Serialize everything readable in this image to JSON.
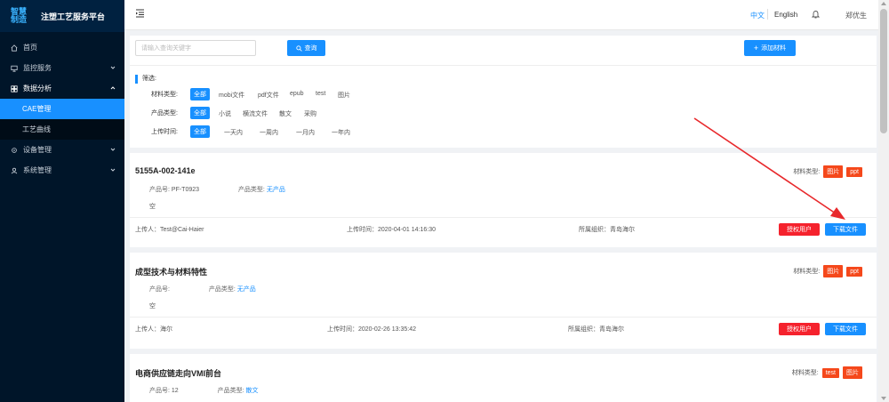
{
  "sidebar": {
    "logo_line1": "智慧",
    "logo_line2": "制造",
    "title": "注塑工艺服务平台",
    "items": [
      {
        "label": "首页"
      },
      {
        "label": "监控服务"
      },
      {
        "label": "数据分析"
      },
      {
        "label": "设备管理"
      },
      {
        "label": "系统管理"
      }
    ],
    "sub_items": [
      {
        "label": "CAE管理"
      },
      {
        "label": "工艺曲线"
      }
    ]
  },
  "header": {
    "lang_zh": "中文",
    "lang_en": "English",
    "user": "郑优生"
  },
  "search": {
    "placeholder": "请输入查询关键字",
    "query_label": "查询",
    "add_label": "添加材料"
  },
  "filter": {
    "title": "筛选:",
    "material_label": "材料类型:",
    "material_options": [
      "全部",
      "mobi文件",
      "pdf文件",
      "epub",
      "test",
      "图片"
    ],
    "product_label": "产品类型:",
    "product_options": [
      "全部",
      "小说",
      "横流文件",
      "散文",
      "采购"
    ],
    "time_label": "上传时间:",
    "time_options": [
      "全部",
      "一天内",
      "一周内",
      "一月内",
      "一年内"
    ]
  },
  "cards": [
    {
      "title": "5155A-002-141e",
      "product_no_label": "产品号:",
      "product_no": "PF-T0923",
      "product_type_label": "产品类型:",
      "product_type": "无产品",
      "desc": "空",
      "types_label": "材料类型:",
      "tags": [
        "图片",
        "ppt"
      ],
      "uploader": "上传人：Test@Cai-Haier",
      "upload_time": "上传时间：2020-04-01 14:16:30",
      "org": "所属组织：青岛海尔",
      "auth_label": "授权用户",
      "download_label": "下载文件"
    },
    {
      "title": "成型技术与材料特性",
      "product_no_label": "产品号:",
      "product_no": "",
      "product_type_label": "产品类型:",
      "product_type": "无产品",
      "desc": "空",
      "types_label": "材料类型:",
      "tags": [
        "图片",
        "ppt"
      ],
      "uploader": "上传人：海尔",
      "upload_time": "上传时间：2020-02-26 13:35:42",
      "org": "所属组织：青岛海尔",
      "auth_label": "授权用户",
      "download_label": "下载文件"
    },
    {
      "title": "电商供应链走向VMI前台",
      "product_no_label": "产品号:",
      "product_no": "12",
      "product_type_label": "产品类型:",
      "product_type": "散文",
      "types_label": "材料类型:",
      "tags": [
        "test",
        "图片"
      ]
    }
  ],
  "colors": {
    "sidebar_bg": "#001529",
    "primary": "#1890ff",
    "danger": "#f5222d",
    "tag": "#f5481b",
    "annotation_arrow": "#e8282b"
  }
}
